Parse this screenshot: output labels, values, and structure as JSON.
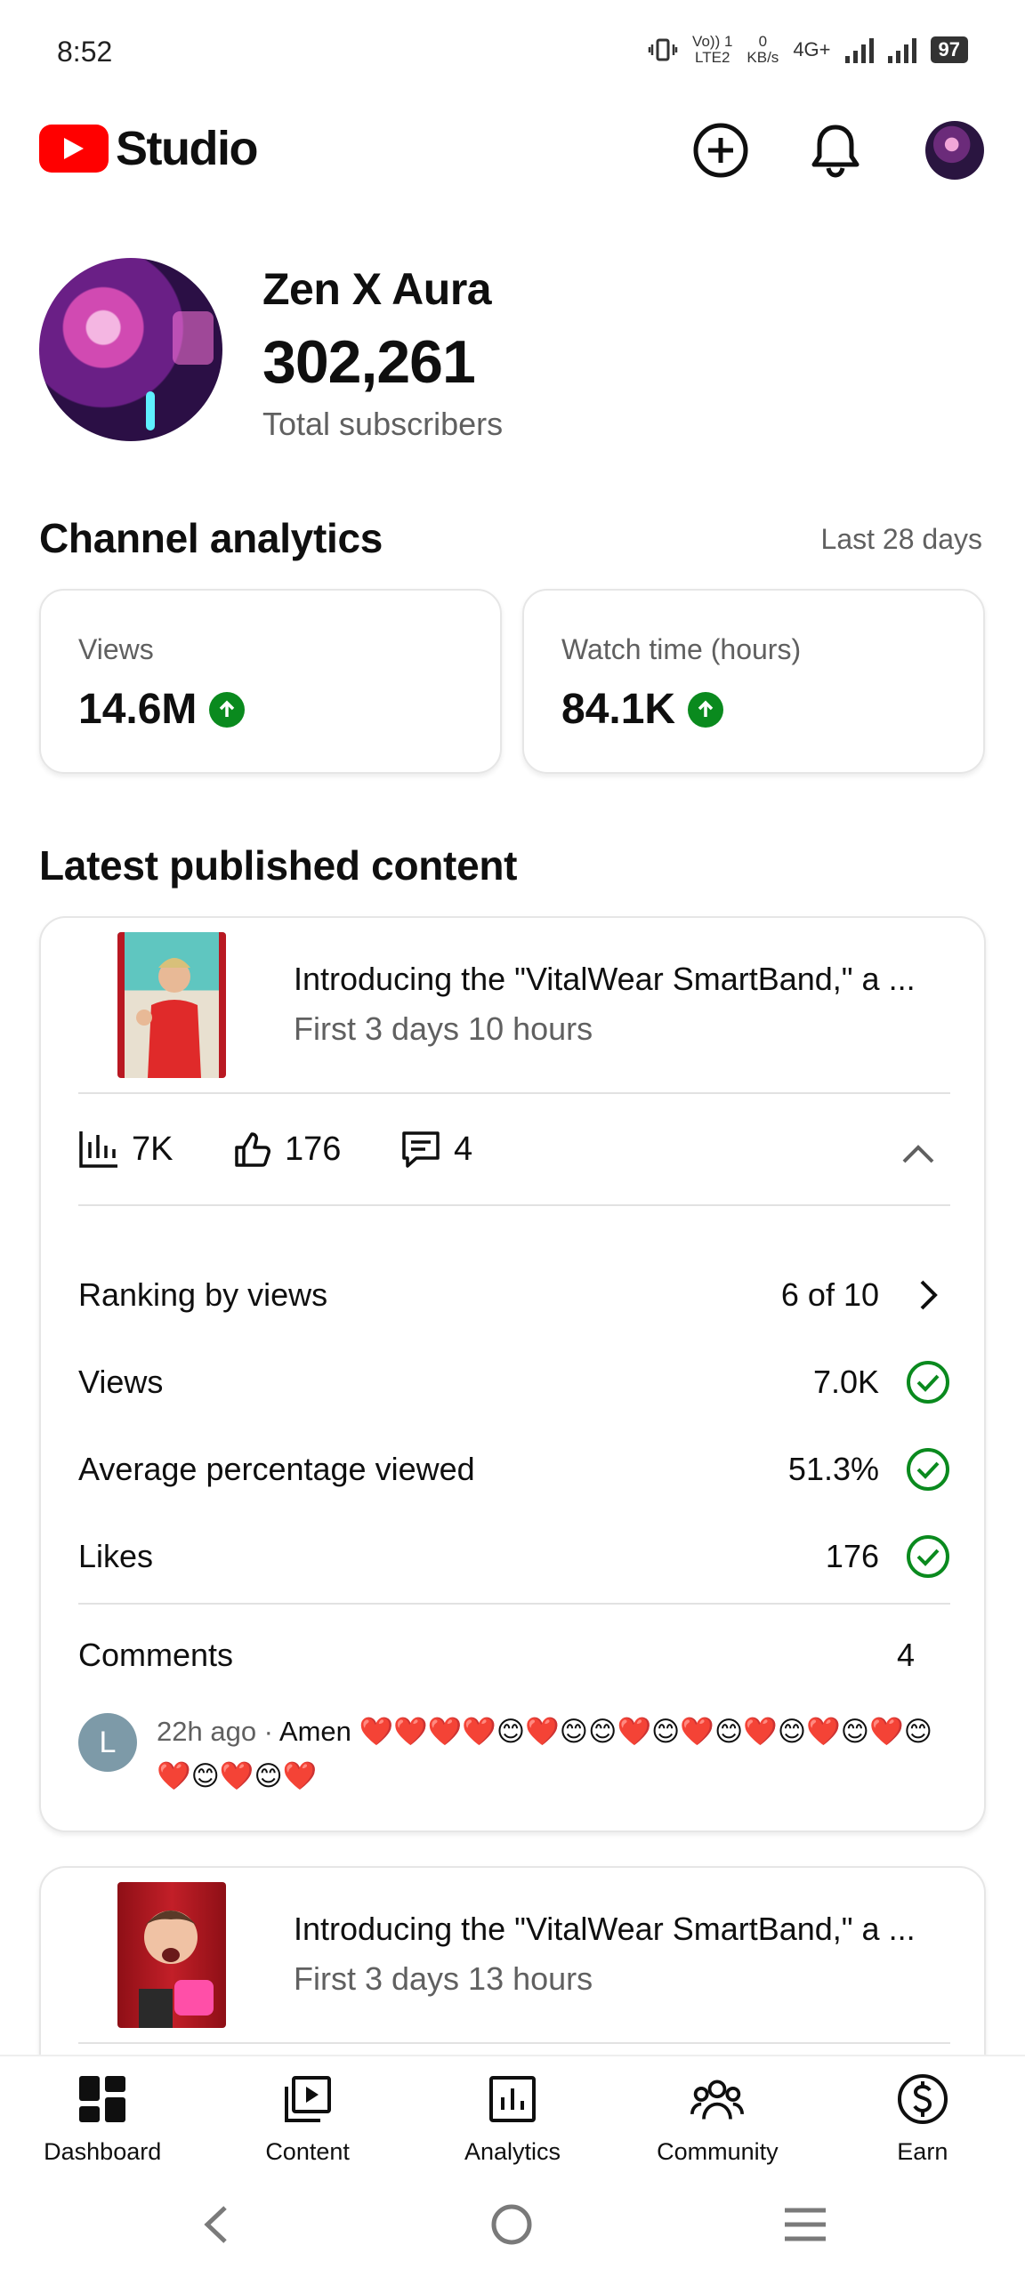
{
  "status_bar": {
    "time": "8:52",
    "volte_top": "Vo)) 1",
    "volte_bottom": "LTE2",
    "speed_value": "0",
    "speed_unit": "KB/s",
    "network": "4G+",
    "battery": "97"
  },
  "header": {
    "app_name": "Studio",
    "brand_color": "#ff0000"
  },
  "channel": {
    "name": "Zen X Aura",
    "subscribers": "302,261",
    "subscribers_label": "Total subscribers"
  },
  "analytics": {
    "title": "Channel analytics",
    "period": "Last 28 days",
    "cards": [
      {
        "label": "Views",
        "value": "14.6M",
        "trend": "up"
      },
      {
        "label": "Watch time (hours)",
        "value": "84.1K",
        "trend": "up"
      }
    ],
    "trend_color": "#0a8a1e"
  },
  "latest": {
    "title": "Latest published content",
    "videos": [
      {
        "title": "Introducing the \"VitalWear SmartBand,\" a ...",
        "subtitle": "First 3 days 10 hours",
        "views": "7K",
        "likes": "176",
        "comments": "4",
        "details": [
          {
            "label": "Ranking by views",
            "value": "6 of 10",
            "indicator": "chevron-right"
          },
          {
            "label": "Views",
            "value": "7.0K",
            "indicator": "check"
          },
          {
            "label": "Average percentage viewed",
            "value": "51.3%",
            "indicator": "check"
          },
          {
            "label": "Likes",
            "value": "176",
            "indicator": "check"
          }
        ],
        "comments_label": "Comments",
        "comments_count": "4",
        "top_comment": {
          "avatar_letter": "L",
          "meta": "22h ago · ",
          "text": "Amen ❤️❤️❤️❤️😊❤️😊😊❤️😊❤️😊❤️😊❤️😊❤️😊❤️😊❤️😊❤️"
        }
      },
      {
        "title": "Introducing the \"VitalWear SmartBand,\" a ...",
        "subtitle": "First 3 days 13 hours"
      }
    ]
  },
  "bottom_nav": {
    "items": [
      {
        "label": "Dashboard",
        "icon": "dashboard-icon",
        "active": true
      },
      {
        "label": "Content",
        "icon": "content-icon"
      },
      {
        "label": "Analytics",
        "icon": "analytics-icon"
      },
      {
        "label": "Community",
        "icon": "community-icon"
      },
      {
        "label": "Earn",
        "icon": "earn-icon"
      }
    ]
  }
}
